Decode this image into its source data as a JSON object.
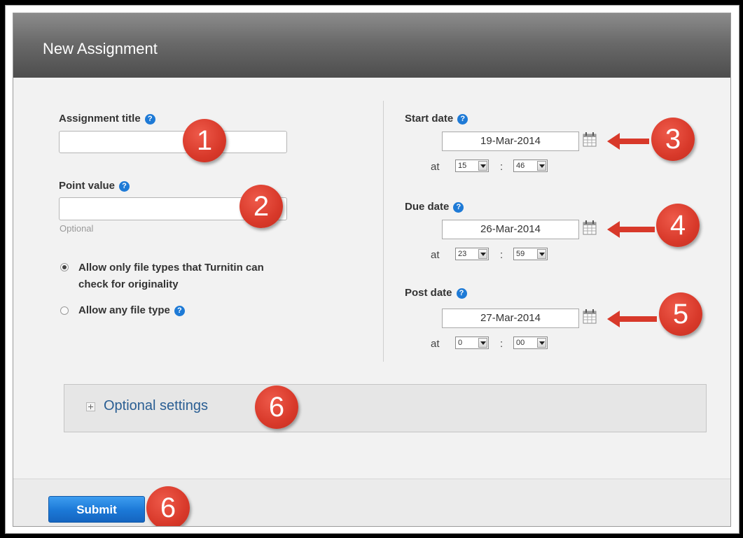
{
  "header": {
    "title": "New Assignment"
  },
  "form": {
    "assignment_title": {
      "label": "Assignment title",
      "value": ""
    },
    "point_value": {
      "label": "Point value",
      "value": "",
      "hint": "Optional"
    },
    "file_types": {
      "option1": "Allow only file types that Turnitin can check for originality",
      "option1_line1": "Allow only file types that Turnitin can",
      "option1_line2": "check for originality",
      "option2": "Allow any file type",
      "selected": "option1"
    },
    "start": {
      "label": "Start date",
      "date": "19-Mar-2014",
      "at": "at",
      "hour": "15",
      "minute": "46"
    },
    "due": {
      "label": "Due date",
      "date": "26-Mar-2014",
      "at": "at",
      "hour": "23",
      "minute": "59"
    },
    "post": {
      "label": "Post date",
      "date": "27-Mar-2014",
      "at": "at",
      "hour": "0",
      "minute": "00"
    },
    "colon": ":"
  },
  "optional_settings": {
    "label": "Optional settings"
  },
  "footer": {
    "submit": "Submit"
  },
  "annotations": {
    "badge1": "1",
    "badge2": "2",
    "badge3": "3",
    "badge4": "4",
    "badge5": "5",
    "badge6a": "6",
    "badge6b": "6",
    "color": "#d8392a"
  },
  "icons": {
    "help": "help-icon",
    "calendar": "calendar-icon",
    "expand": "plus-icon"
  },
  "colors": {
    "accent": "#1e7ad6",
    "link": "#2a5e93",
    "submit": "#1b78d6"
  }
}
